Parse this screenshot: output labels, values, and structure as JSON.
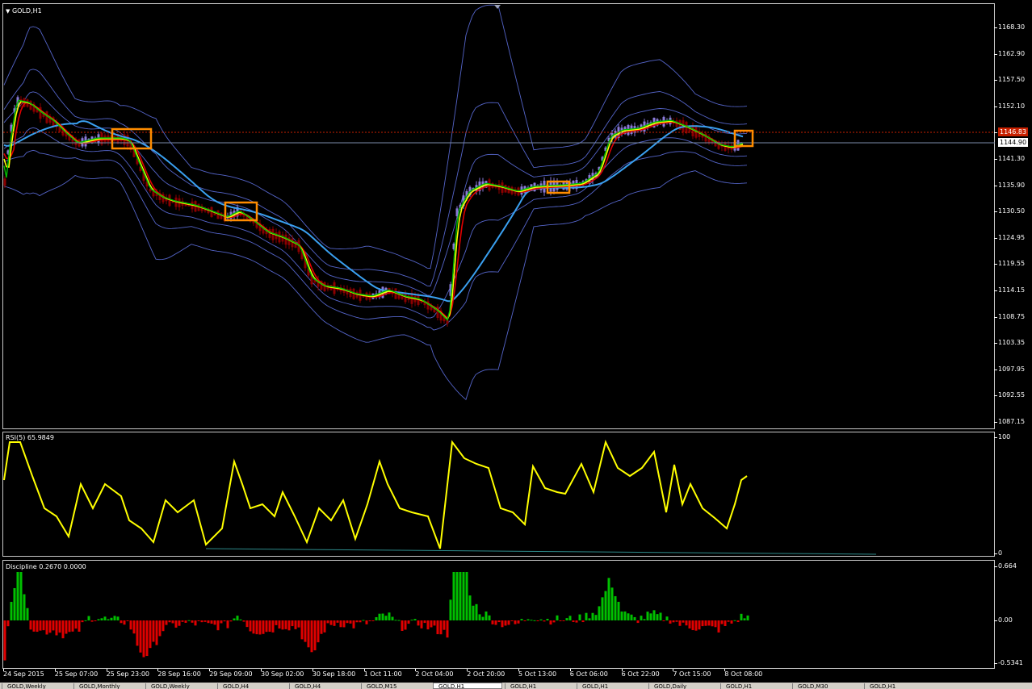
{
  "main_chart": {
    "symbol_label": "GOLD,H1",
    "price_ticks": [
      "1168.30",
      "1162.90",
      "1157.50",
      "1152.10",
      "1146.70",
      "1141.30",
      "1135.90",
      "1130.50",
      "1124.95",
      "1119.55",
      "1114.15",
      "1108.75",
      "1103.35",
      "1097.95",
      "1092.55",
      "1087.15"
    ],
    "bid_label": "1146.83",
    "current_label": "1144.90",
    "colors": {
      "bull": "#8a7ad8",
      "bear": "#8b0000",
      "bands": "#5464c8",
      "ma_slow": "#3aa0f0",
      "ma1": "#e00000",
      "ma2": "#ffff00",
      "ma3": "#00c000",
      "highlight": "#ff8c00",
      "bid_line": "#c82000"
    }
  },
  "rsi": {
    "title": "RSI(5) 65.9849",
    "scale_max": "100",
    "scale_min": "0",
    "color": "#ffff00"
  },
  "discipline": {
    "title": "Discipline 0.2670 0.0000",
    "scale_top": "0.664",
    "scale_mid": "0.00",
    "scale_bottom": "-0.5341",
    "colors": {
      "up": "#00c000",
      "down": "#e00000"
    }
  },
  "time_axis": [
    "24 Sep 2015",
    "25 Sep 07:00",
    "25 Sep 23:00",
    "28 Sep 16:00",
    "29 Sep 09:00",
    "30 Sep 02:00",
    "30 Sep 18:00",
    "1 Oct 11:00",
    "2 Oct 04:00",
    "2 Oct 20:00",
    "5 Oct 13:00",
    "6 Oct 06:00",
    "6 Oct 22:00",
    "7 Oct 15:00",
    "8 Oct 08:00"
  ],
  "tabs": [
    "GOLD,Weekly",
    "GOLD,Monthly",
    "GOLD,Weekly",
    "GOLD,H4",
    "GOLD,H4",
    "GOLD,M15",
    "GOLD,H1",
    "GOLD,H1",
    "GOLD,H1",
    "GOLD,Daily",
    "GOLD,H1",
    "GOLD,M30",
    "GOLD,H1"
  ]
}
